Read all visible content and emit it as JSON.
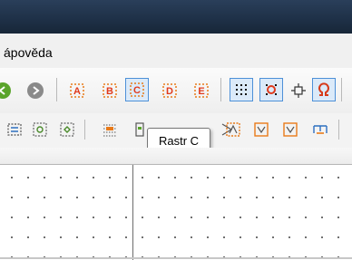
{
  "menu": {
    "visible_item": "ápověda"
  },
  "toolbar": {
    "tooltip_text": "Rastr C",
    "icons_row1": [
      "back-icon",
      "forward-icon",
      "grid-a-icon",
      "grid-b-icon",
      "grid-c-icon",
      "grid-d-icon",
      "grid-e-icon",
      "grid-dots-icon",
      "snap-icon",
      "crosshair-icon",
      "omega-icon"
    ],
    "icons_row2": [
      "component-icon",
      "component-alt-icon",
      "component-alt2-icon",
      "grid-tool-icon",
      "rastr-c-icon",
      "select-icon",
      "link-icon",
      "place-icon",
      "place-alt-icon",
      "place-alt2-icon"
    ]
  },
  "colors": {
    "titlebar": "#1f3148",
    "accent_active": "#4d90d8",
    "icon_red": "#e03a1c",
    "icon_orange": "#e87a19",
    "nav_green": "#5aa42b",
    "nav_gray": "#8a8a8a"
  }
}
